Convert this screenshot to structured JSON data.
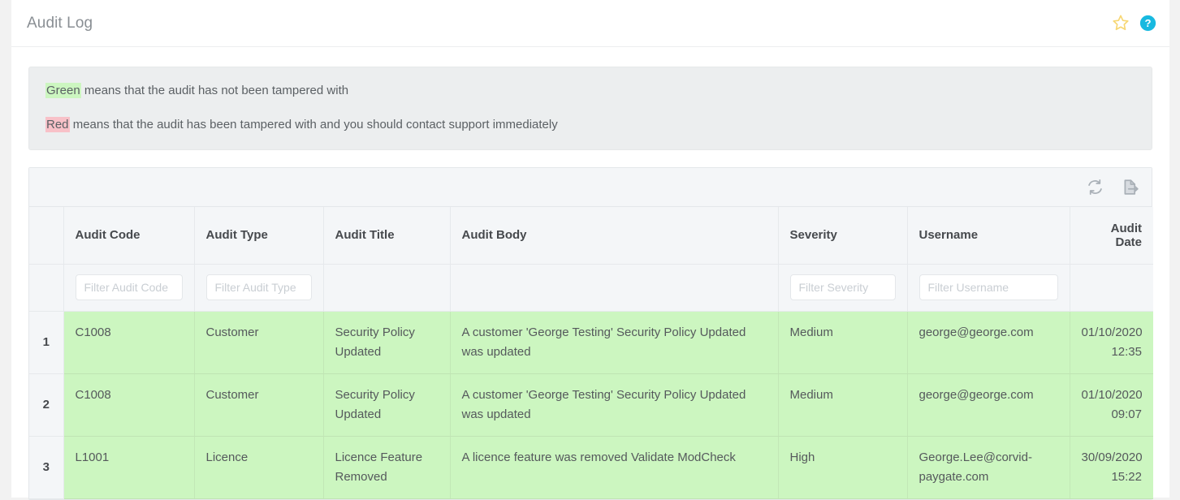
{
  "header": {
    "title": "Audit Log",
    "icons": [
      {
        "name": "favourite-star-icon",
        "label": "star"
      },
      {
        "name": "help-icon",
        "label": "?"
      }
    ]
  },
  "info_panel": {
    "lines": [
      {
        "highlight": "Green",
        "highlight_color": "#ccf6c0",
        "text": " means that the audit has not been tampered with"
      },
      {
        "highlight": "Red",
        "highlight_color": "#f8c1c8",
        "text": " means that the audit has been tampered with and you should contact support immediately"
      }
    ]
  },
  "grid": {
    "toolbar": {
      "refresh_label": "refresh",
      "export_label": "export"
    },
    "columns": [
      {
        "key": "num",
        "label": ""
      },
      {
        "key": "code",
        "label": "Audit Code"
      },
      {
        "key": "type",
        "label": "Audit Type"
      },
      {
        "key": "title",
        "label": "Audit Title"
      },
      {
        "key": "body",
        "label": "Audit Body"
      },
      {
        "key": "sev",
        "label": "Severity"
      },
      {
        "key": "user",
        "label": "Username"
      },
      {
        "key": "date",
        "label": "Audit Date"
      }
    ],
    "filters": {
      "audit_code": {
        "value": "",
        "placeholder": "Filter Audit Code"
      },
      "audit_type": {
        "value": "",
        "placeholder": "Filter Audit Type"
      },
      "audit_title": null,
      "audit_body": null,
      "severity": {
        "value": "",
        "placeholder": "Filter Severity"
      },
      "username": {
        "value": "",
        "placeholder": "Filter Username"
      },
      "audit_date": null
    },
    "rows": [
      {
        "num": "1",
        "code": "C1008",
        "type": "Customer",
        "title": "Security Policy Updated",
        "body": "A customer 'George Testing' Security Policy Updated was updated",
        "severity": "Medium",
        "username": "george@george.com",
        "date": "01/10/2020 12:35",
        "status": "untampered",
        "row_color": "#ccf6c0"
      },
      {
        "num": "2",
        "code": "C1008",
        "type": "Customer",
        "title": "Security Policy Updated",
        "body": "A customer 'George Testing' Security Policy Updated was updated",
        "severity": "Medium",
        "username": "george@george.com",
        "date": "01/10/2020 09:07",
        "status": "untampered",
        "row_color": "#ccf6c0"
      },
      {
        "num": "3",
        "code": "L1001",
        "type": "Licence",
        "title": "Licence Feature Removed",
        "body": "A licence feature was removed Validate ModCheck",
        "severity": "High",
        "username": "George.Lee@corvid-paygate.com",
        "date": "30/09/2020 15:22",
        "status": "untampered",
        "row_color": "#ccf6c0"
      }
    ]
  },
  "colors": {
    "untampered": "#ccf6c0",
    "tampered": "#f8c1c8",
    "header_bg": "#f4f6f8",
    "accent_help": "#18b9e0",
    "accent_star": "#f6d365"
  }
}
